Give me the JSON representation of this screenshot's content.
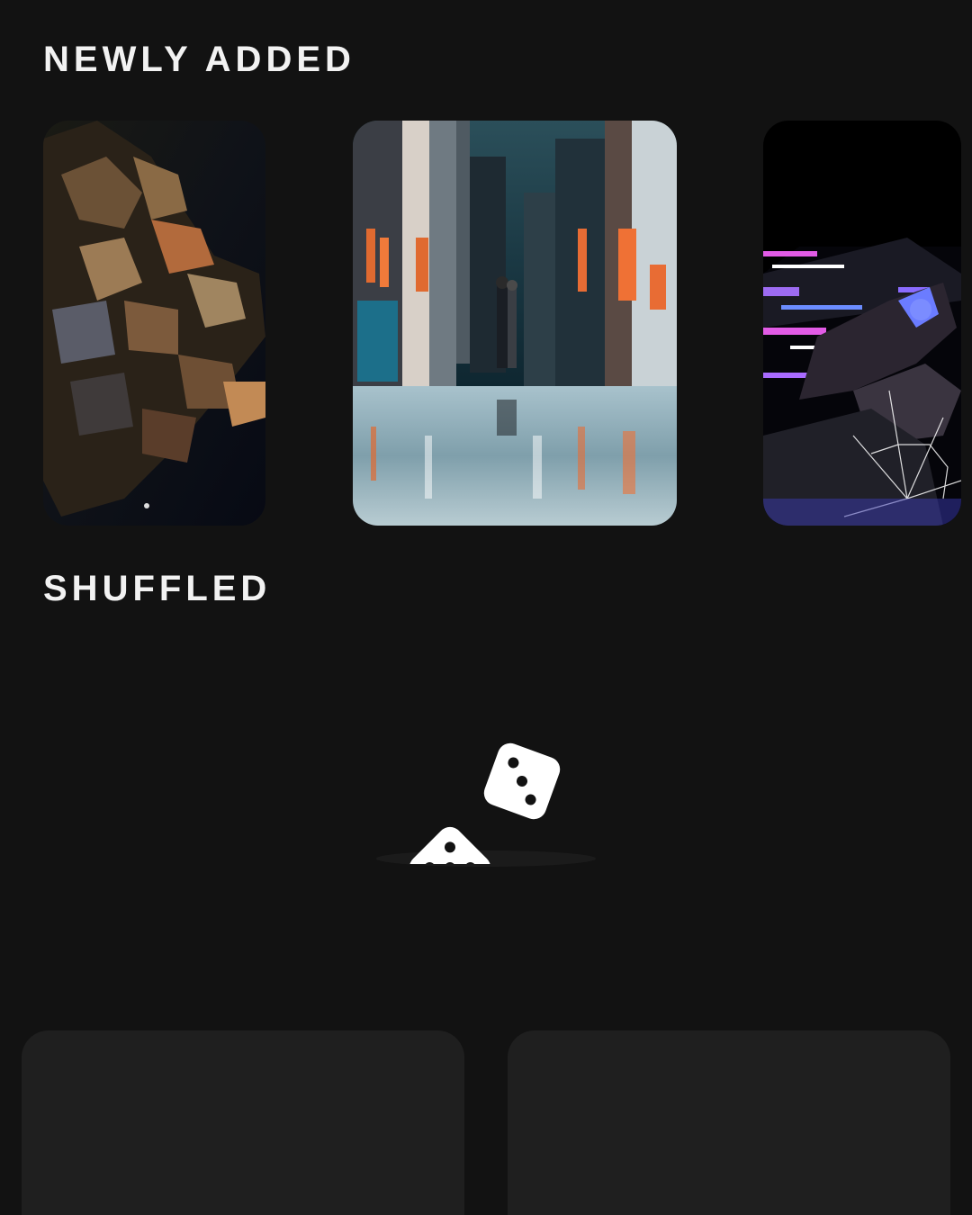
{
  "sections": {
    "newly_added": {
      "title": "NEWLY ADDED"
    },
    "shuffled": {
      "title": "SHUFFLED"
    }
  },
  "newly_added_items": [
    {
      "name": "aerial-rooftops-night"
    },
    {
      "name": "city-street-reflection"
    },
    {
      "name": "anime-neon-glitch"
    }
  ],
  "shuffled_items": [
    {
      "name": "placeholder-1"
    },
    {
      "name": "placeholder-2"
    }
  ],
  "loader": {
    "icon": "dice-icon"
  },
  "colors": {
    "background": "#121212",
    "card_placeholder": "#1f1f1f",
    "text": "#f2f2f2"
  }
}
